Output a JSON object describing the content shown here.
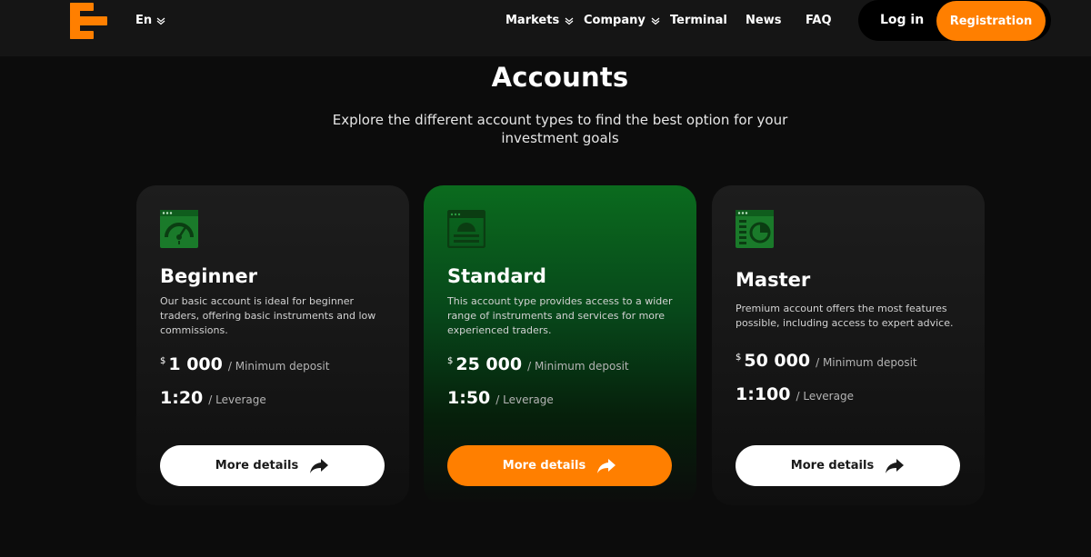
{
  "header": {
    "language": "En",
    "nav": [
      {
        "label": "Markets",
        "dropdown": true
      },
      {
        "label": "Company",
        "dropdown": true
      },
      {
        "label": "Terminal",
        "dropdown": false
      },
      {
        "label": "News",
        "dropdown": false
      },
      {
        "label": "FAQ",
        "dropdown": false
      }
    ],
    "login_label": "Log in",
    "register_label": "Registration"
  },
  "page": {
    "title": "Accounts",
    "subtitle": "Explore the different account types to find the best option for your investment goals"
  },
  "cards": [
    {
      "name": "Beginner",
      "icon": "speedometer-icon",
      "description": "Our basic account is ideal for beginner traders, offering basic instruments and low commissions.",
      "currency": "$",
      "deposit": "1 000",
      "deposit_label": "/ Minimum deposit",
      "leverage": "1:20",
      "leverage_label": "/ Leverage",
      "button_label": "More details",
      "highlighted": false
    },
    {
      "name": "Standard",
      "icon": "gauge-window-icon",
      "description": "This account type provides access to a wider range of instruments and services for more experienced traders.",
      "currency": "$",
      "deposit": "25 000",
      "deposit_label": "/ Minimum deposit",
      "leverage": "1:50",
      "leverage_label": "/ Leverage",
      "button_label": "More details",
      "highlighted": true
    },
    {
      "name": "Master",
      "icon": "dashboard-chart-icon",
      "description": "Premium account offers the most features possible, including access to expert advice.",
      "currency": "$",
      "deposit": "50 000",
      "deposit_label": "/ Minimum deposit",
      "leverage": "1:100",
      "leverage_label": "/ Leverage",
      "button_label": "More details",
      "highlighted": false
    }
  ],
  "colors": {
    "accent": "#ff7f00",
    "highlight_card": "#0b6b1e",
    "icon_green": "#1a7a2a",
    "background": "#0c0c0c"
  }
}
